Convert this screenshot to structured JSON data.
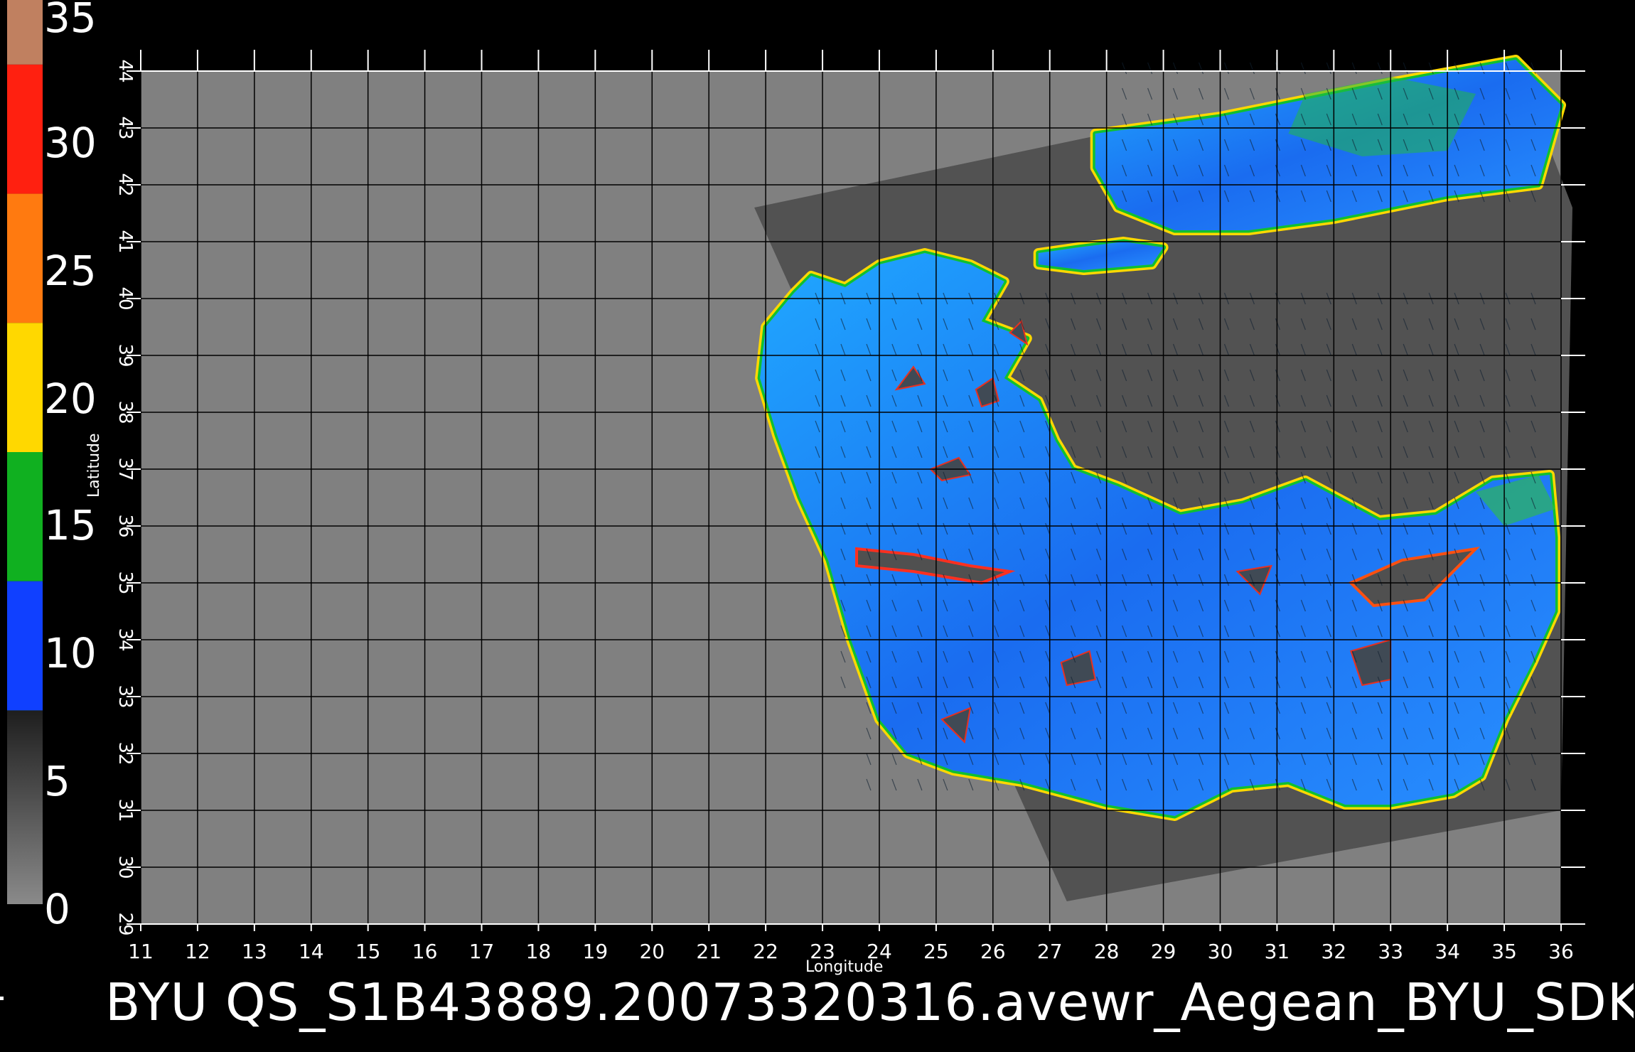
{
  "colorbar": {
    "labels": [
      "35",
      "30",
      "25",
      "20",
      "15",
      "10",
      "5",
      "0"
    ],
    "bands": [
      {
        "from": 32.5,
        "to": 35,
        "color": "#c08060"
      },
      {
        "from": 27.5,
        "to": 32.5,
        "color": "#ff2010"
      },
      {
        "from": 22.5,
        "to": 27.5,
        "color": "#ff7a10"
      },
      {
        "from": 17.5,
        "to": 22.5,
        "color": "#ffd800"
      },
      {
        "from": 12.5,
        "to": 17.5,
        "color": "#10b020"
      },
      {
        "from": 7.5,
        "to": 12.5,
        "color": "#1040ff"
      },
      {
        "from": 2.5,
        "to": 7.5,
        "color": "#00e8ff"
      },
      {
        "from": 0,
        "to": 2.5,
        "color": "#6a6a6a"
      }
    ]
  },
  "map": {
    "xlabel": "Longitude",
    "ylabel": "Latitude",
    "lon_ticks": [
      "11",
      "12",
      "13",
      "14",
      "15",
      "16",
      "17",
      "18",
      "19",
      "20",
      "21",
      "22",
      "23",
      "24",
      "25",
      "26",
      "27",
      "28",
      "29",
      "30",
      "31",
      "32",
      "33",
      "34",
      "35",
      "36"
    ],
    "lat_ticks": [
      "29",
      "30",
      "31",
      "32",
      "33",
      "34",
      "35",
      "36",
      "37",
      "38",
      "39",
      "40",
      "41",
      "42",
      "43",
      "44"
    ],
    "lon_range": [
      11,
      36
    ],
    "lat_range": [
      29,
      44
    ],
    "background_color": "#808080",
    "swath_color": "#525252",
    "land_color": "#505050",
    "grid": true
  },
  "caption": "BYU QS_S1B43889.20073320316.avewr_Aegean_BYU_SDK"
}
